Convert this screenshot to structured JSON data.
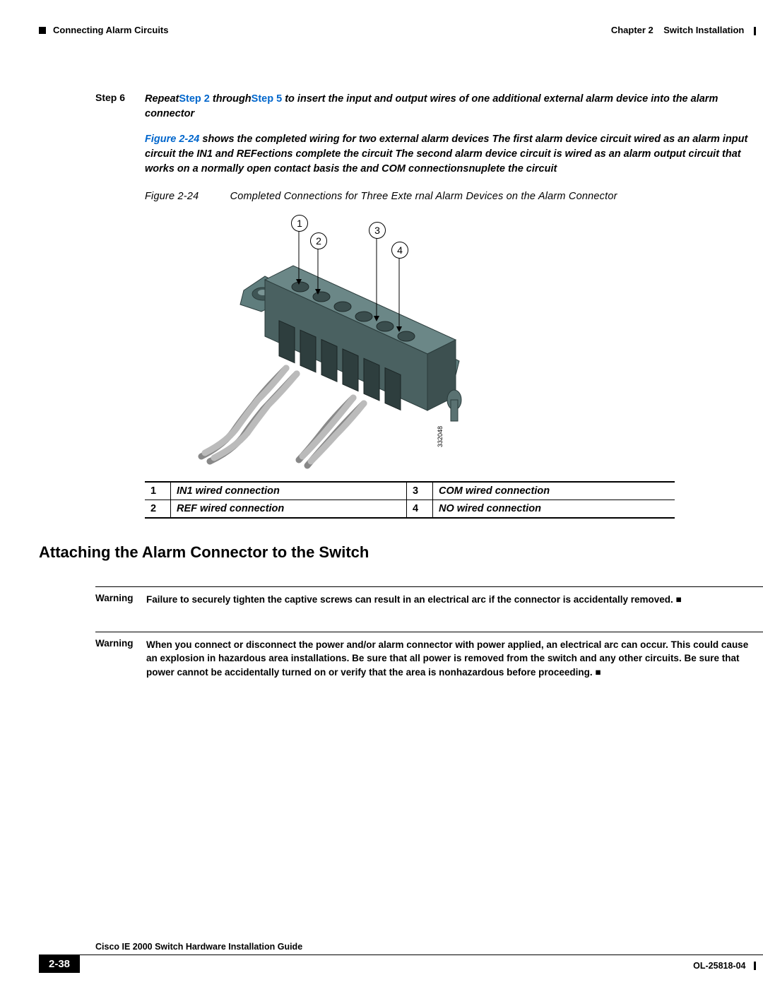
{
  "header": {
    "section_left": "Connecting Alarm Circuits",
    "chapter": "Chapter 2",
    "chapter_title": "Switch Installation"
  },
  "step6": {
    "label": "Step 6",
    "pre": "Repeat",
    "link1": "Step 2",
    "mid1": " through",
    "link2": "Step 5",
    "post": " to insert the input and output wires of one additional external alarm device into the alarm connector"
  },
  "para1": {
    "link": "Figure 2-24",
    "text": " shows the completed wiring for two external alarm devices The first alarm device circuit wired as an alarm input circuit the IN1 and REFections complete the circuit The second alarm device circuit is wired as an alarm output circuit that works on a normally open contact basis the and COM connectionsnuplete the circuit"
  },
  "figure": {
    "num": "Figure 2-24",
    "title": "Completed Connections for Three Exte        rnal Alarm Devices on      the Alarm Connector",
    "imgnum": "332048"
  },
  "legend": {
    "r1c1": "1",
    "r1c2": "IN1 wired connection",
    "r1c3": "3",
    "r1c4": "COM wired connection",
    "r2c1": "2",
    "r2c2": "REF wired connection",
    "r2c3": "4",
    "r2c4": "NO wired connection"
  },
  "section_heading": "Attaching the Alarm Connector to the Switch",
  "warning1": {
    "label": "Warning",
    "text": "Failure to securely tighten the captive screws can result in an electrical arc if the connector is accidentally removed. ■"
  },
  "warning2": {
    "label": "Warning",
    "text": "When you connect or disconnect the power and/or alarm connector with power applied, an electrical arc can occur. This could cause an explosion in hazardous area installations. Be sure that all power is removed from the switch and any other circuits. Be sure that power cannot be accidentally turned on or verify that the area is nonhazardous before proceeding. ■"
  },
  "footer": {
    "title": "Cisco IE 2000 Switch Hardware Installation Guide",
    "page": "2-38",
    "docid": "OL-25818-04"
  },
  "callouts": {
    "c1": "1",
    "c2": "2",
    "c3": "3",
    "c4": "4"
  }
}
